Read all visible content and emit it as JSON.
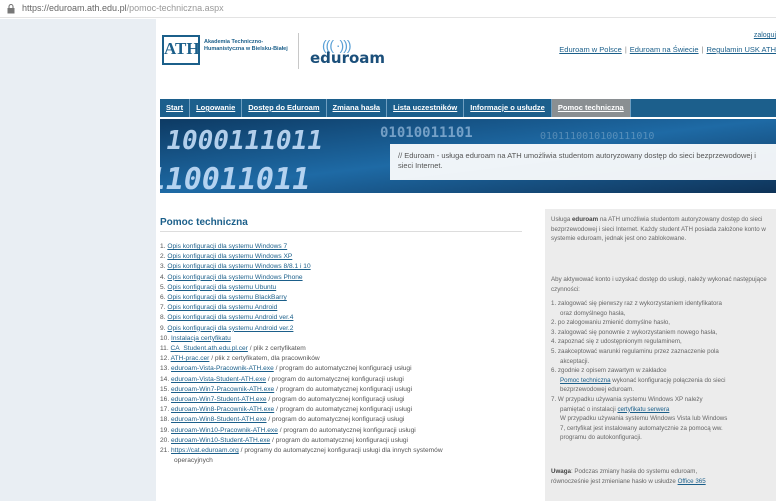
{
  "browser": {
    "url_host": "https://eduroam.ath.edu.pl",
    "url_path": "/pomoc-techniczna.aspx",
    "lock_icon": "lock-icon"
  },
  "header": {
    "ath_logo_text": "ATH",
    "ath_name": "Akademia Techniczno-Humanistyczna w Bielsku-Białej",
    "eduroam_logo": "eduroam",
    "logout": "zaloguj",
    "links": [
      "Eduroam w Polsce",
      "Eduroam na Świecie",
      "Regulamin USK ATH"
    ]
  },
  "nav": {
    "items": [
      "Start",
      "Logowanie",
      "Dostęp do Eduroam",
      "Zmiana hasła",
      "Lista uczestników",
      "Informacje o usłudze",
      "Pomoc techniczna"
    ],
    "active_index": 6
  },
  "banner": {
    "text": "// Eduroam - usługa eduroam na ATH umożliwia studentom autoryzowany dostęp do sieci bezprzewodowej i sieci Internet."
  },
  "content": {
    "title": "Pomoc techniczna",
    "items": [
      {
        "num": "1.",
        "link": "Opis konfiguracji dla systemu Windows 7",
        "rest": ""
      },
      {
        "num": "2.",
        "link": "Opis konfiguracji dla systemu Windows XP",
        "rest": ""
      },
      {
        "num": "3.",
        "link": "Opis konfiguracji dla systemu Windows 8/8.1 i 10",
        "rest": ""
      },
      {
        "num": "4.",
        "link": "Opis konfiguracji dla systemu Windows Phone",
        "rest": ""
      },
      {
        "num": "5.",
        "link": "Opis konfiguracji dla systemu Ubuntu",
        "rest": ""
      },
      {
        "num": "6.",
        "link": "Opis konfiguracji dla systemu BlackBarry",
        "rest": ""
      },
      {
        "num": "7.",
        "link": "Opis konfiguracji dla systemu Android",
        "rest": ""
      },
      {
        "num": "8.",
        "link": "Opis konfiguracji dla systemu Android ver.4",
        "rest": ""
      },
      {
        "num": "9.",
        "link": "Opis konfiguracji dla systemu Android ver.2",
        "rest": ""
      },
      {
        "num": "10.",
        "link": "Instalacja certyfikatu",
        "rest": ""
      },
      {
        "num": "11.",
        "link": "CA_Student.ath.edu.pl.cer",
        "rest": " / plik z certyfikatem"
      },
      {
        "num": "12.",
        "link": "ATH-prac.cer",
        "rest": " / plik z certyfikatem, dla pracowników"
      },
      {
        "num": "13.",
        "link": "eduroam-Vista-Pracownik-ATH.exe",
        "rest": " / program do automatycznej konfiguracji usługi"
      },
      {
        "num": "14.",
        "link": "eduroam-Vista-Student-ATH.exe",
        "rest": " / program do automatycznej konfiguracji usługi"
      },
      {
        "num": "15.",
        "link": "eduroam-Win7-Pracownik-ATH.exe",
        "rest": " / program do automatycznej konfiguracji usługi"
      },
      {
        "num": "16.",
        "link": "eduroam-Win7-Student-ATH.exe",
        "rest": " / program do automatycznej konfiguracji usługi"
      },
      {
        "num": "17.",
        "link": "eduroam-Win8-Pracownik-ATH.exe",
        "rest": " / program do automatycznej konfiguracji usługi"
      },
      {
        "num": "18.",
        "link": "eduroam-Win8-Student-ATH.exe",
        "rest": " / program do automatycznej konfiguracji usługi"
      },
      {
        "num": "19.",
        "link": "eduroam-Win10-Pracownik-ATH.exe",
        "rest": " / program do automatycznej konfiguracji usługi"
      },
      {
        "num": "20.",
        "link": "eduroam-Win10-Student-ATH.exe",
        "rest": " / program do automatycznej konfiguracji usługi"
      },
      {
        "num": "21.",
        "link": "https://cat.eduroam.org",
        "rest": " / programy do automatycznej konfiguracji usługi dla innych systemów"
      }
    ],
    "item21_cont": "operacyjnych"
  },
  "infobox": {
    "p1_pre": "Usługa ",
    "p1_bold": "eduroam",
    "p1_post": " na ATH umożliwia studentom autoryzowany dostęp do sieci bezprzewodowej i sieci Internet. Każdy student ATH posiada założone konto w systemie eduroam, jednak jest ono zablokowane.",
    "p2": "Aby aktywować konto i uzyskać dostęp do usługi, należy wykonać następujące czynności:",
    "steps": [
      {
        "num": "1.",
        "text": "zalogować się pierwszy raz z wykorzystaniem identyfikatora",
        "cont": "oraz domyślnego hasła,"
      },
      {
        "num": "2.",
        "text": "po zalogowaniu zmienić domyślne hasło,",
        "cont": ""
      },
      {
        "num": "3.",
        "text": "zalogować się ponownie z wykorzystaniem nowego hasła,",
        "cont": ""
      },
      {
        "num": "4.",
        "text": "zapoznać się z udostępnionym regulaminem,",
        "cont": ""
      },
      {
        "num": "5.",
        "text": "zaakceptować warunki regulaminu przez zaznaczenie pola",
        "cont": "akceptacji."
      },
      {
        "num": "6.",
        "text": "zgodnie z opisem zawartym w zakładce",
        "link": "Pomoc techniczna",
        "after": " wykonać konfigurację połączenia do sieci",
        "cont": "bezprzewodowej eduroam."
      },
      {
        "num": "7.",
        "text": "W przypadku używania systemu Windows XP należy",
        "cont_pre": "pamiętać o instalacji ",
        "link": "certyfikatu serwera",
        "cont2": "W przypadku używania systemu Windows Vista lub Windows",
        "cont3": "7, certyfikat jest instalowany automatycznie za pomocą ww.",
        "cont4": "programu do autokonfiguracji."
      }
    ],
    "p3_bold": "Uwaga",
    "p3_text": ": Podczas zmiany hasła do systemu eduroam,",
    "p3_line2": "równocześnie jest zmieniane hasło w usłudze ",
    "p3_link": "Office 365"
  }
}
